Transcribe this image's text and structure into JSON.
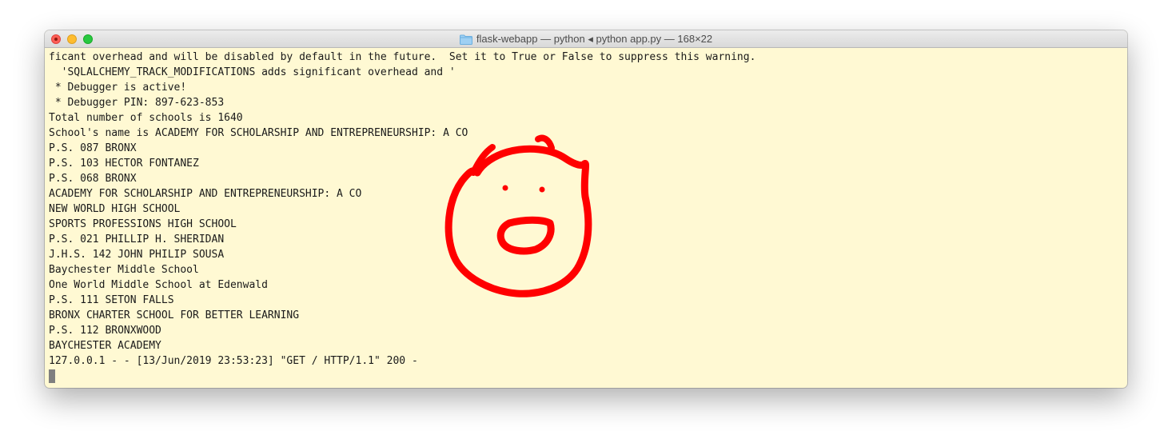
{
  "window": {
    "title": "flask-webapp — python ◂ python app.py — 168×22"
  },
  "terminal": {
    "lines": [
      "ficant overhead and will be disabled by default in the future.  Set it to True or False to suppress this warning.",
      "  'SQLALCHEMY_TRACK_MODIFICATIONS adds significant overhead and '",
      " * Debugger is active!",
      " * Debugger PIN: 897-623-853",
      "Total number of schools is 1640",
      "School's name is ACADEMY FOR SCHOLARSHIP AND ENTREPRENEURSHIP: A CO",
      "P.S. 087 BRONX",
      "P.S. 103 HECTOR FONTANEZ",
      "P.S. 068 BRONX",
      "ACADEMY FOR SCHOLARSHIP AND ENTREPRENEURSHIP: A CO",
      "NEW WORLD HIGH SCHOOL",
      "SPORTS PROFESSIONS HIGH SCHOOL",
      "P.S. 021 PHILLIP H. SHERIDAN",
      "J.H.S. 142 JOHN PHILIP SOUSA",
      "Baychester Middle School",
      "One World Middle School at Edenwald",
      "P.S. 111 SETON FALLS",
      "BRONX CHARTER SCHOOL FOR BETTER LEARNING",
      "P.S. 112 BRONXWOOD",
      "BAYCHESTER ACADEMY",
      "127.0.0.1 - - [13/Jun/2019 23:53:23] \"GET / HTTP/1.1\" 200 -"
    ]
  },
  "colors": {
    "terminal_background": "#fff9d3",
    "doodle_stroke": "#ff0000",
    "close": "#fe5f57",
    "minimize": "#febc2e",
    "zoom": "#28c840"
  },
  "icons": {
    "title_icon": "folder-icon",
    "doodle": "shocked-face-drawing"
  }
}
